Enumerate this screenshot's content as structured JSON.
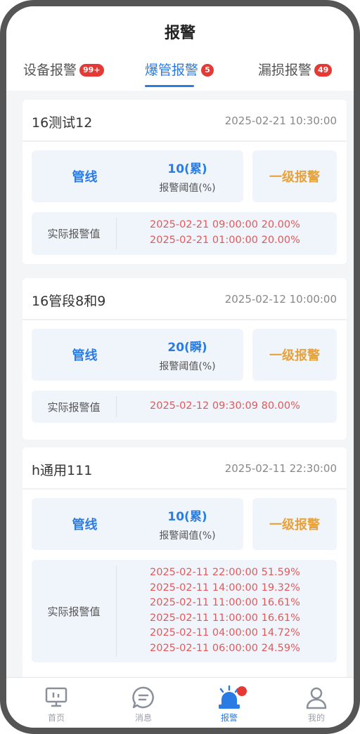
{
  "header": {
    "title": "报警"
  },
  "tabs": [
    {
      "label": "设备报警",
      "badge": "99+",
      "active": false
    },
    {
      "label": "爆管报警",
      "badge": "5",
      "active": true
    },
    {
      "label": "漏损报警",
      "badge": "49",
      "active": false
    }
  ],
  "cards": [
    {
      "name": "16测试12",
      "time": "2025-02-21 10:30:00",
      "type": "管线",
      "threshold_value": "10(累)",
      "threshold_label": "报警阈值(%)",
      "level": "一级报警",
      "actual_label": "实际报警值",
      "actual_values": [
        "2025-02-21 09:00:00 20.00%",
        "2025-02-21 01:00:00 20.00%"
      ]
    },
    {
      "name": "16管段8和9",
      "time": "2025-02-12 10:00:00",
      "type": "管线",
      "threshold_value": "20(瞬)",
      "threshold_label": "报警阈值(%)",
      "level": "一级报警",
      "actual_label": "实际报警值",
      "actual_values": [
        "2025-02-12 09:30:09 80.00%"
      ]
    },
    {
      "name": "h通用111",
      "time": "2025-02-11 22:30:00",
      "type": "管线",
      "threshold_value": "10(累)",
      "threshold_label": "报警阈值(%)",
      "level": "一级报警",
      "actual_label": "实际报警值",
      "actual_values": [
        "2025-02-11 22:00:00 51.59%",
        "2025-02-11 14:00:00 19.32%",
        "2025-02-11 11:00:00 16.61%",
        "2025-02-11 11:00:00 16.61%",
        "2025-02-11 04:00:00 14.72%",
        "2025-02-11 06:00:00 24.59%"
      ]
    }
  ],
  "tabbar": {
    "items": [
      {
        "label": "首页",
        "icon": "monitor-icon",
        "active": false
      },
      {
        "label": "消息",
        "icon": "chat-icon",
        "active": false
      },
      {
        "label": "报警",
        "icon": "alarm-siren-icon",
        "active": true
      },
      {
        "label": "我的",
        "icon": "person-icon",
        "active": false
      }
    ]
  },
  "colors": {
    "accent": "#2a7be4",
    "alarm_level": "#e8a23a",
    "alarm_value": "#e05a5a",
    "badge": "#e53935"
  }
}
